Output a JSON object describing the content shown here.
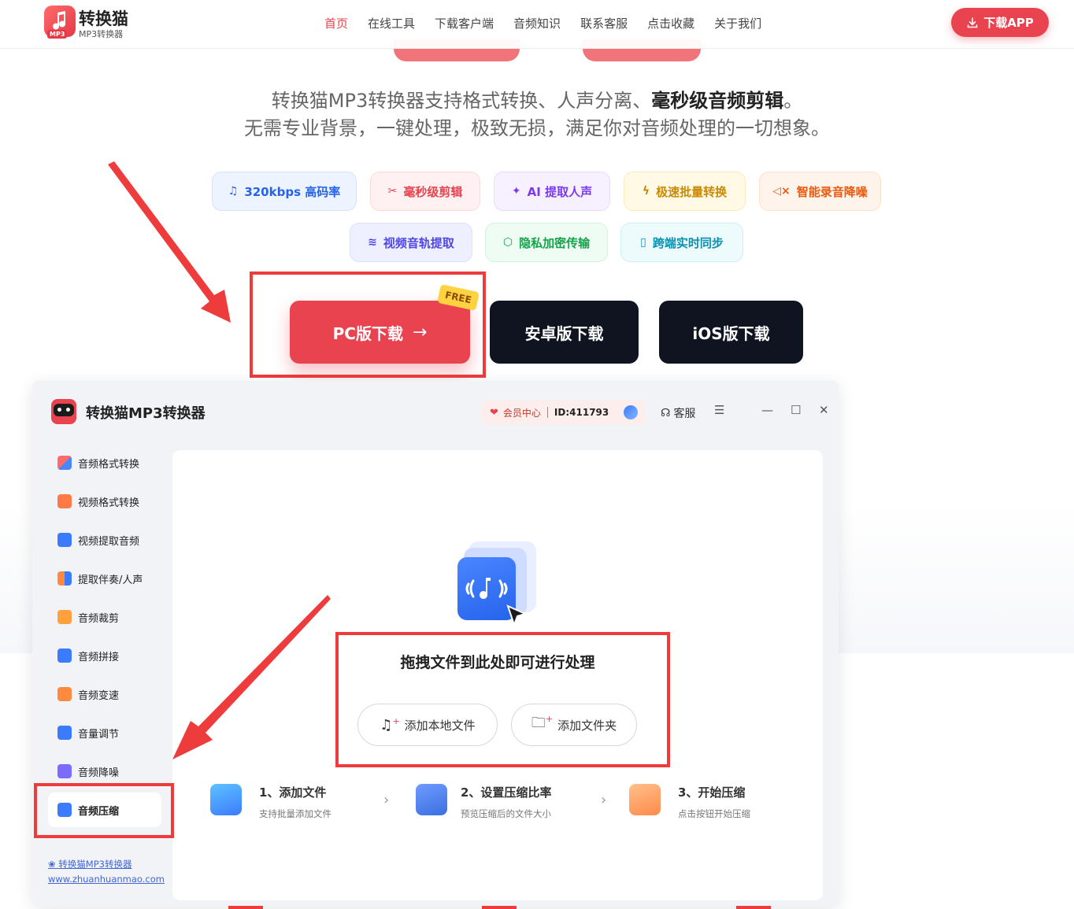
{
  "nav": {
    "logo_title": "转换猫",
    "logo_sub": "MP3转换器",
    "logo_badge": "MP3",
    "items": [
      "首页",
      "在线工具",
      "下载客户端",
      "音频知识",
      "联系客服",
      "点击收藏",
      "关于我们"
    ],
    "download_app": "下载APP"
  },
  "hero": {
    "line1_plain": "转换猫MP3转换器支持格式转换、人声分离、",
    "line1_bold": "毫秒级音频剪辑",
    "line1_end": "。",
    "line2": "无需专业背景，一键处理，极致无损，满足你对音频处理的一切想象。"
  },
  "pills": [
    {
      "label": "320kbps 高码率",
      "icon": "music-note-icon",
      "color": "#2563eb"
    },
    {
      "label": "毫秒级剪辑",
      "icon": "scissors-icon",
      "color": "#e8434f"
    },
    {
      "label": "AI 提取人声",
      "icon": "magic-wand-icon",
      "color": "#7c3aed"
    },
    {
      "label": "极速批量转换",
      "icon": "lightning-icon",
      "color": "#ca8a04"
    },
    {
      "label": "智能录音降噪",
      "icon": "mute-icon",
      "color": "#ea580c"
    },
    {
      "label": "视频音轨提取",
      "icon": "layers-icon",
      "color": "#4f46e5"
    },
    {
      "label": "隐私加密传输",
      "icon": "shield-icon",
      "color": "#16a34a"
    },
    {
      "label": "跨端实时同步",
      "icon": "phone-icon",
      "color": "#0891b2"
    }
  ],
  "downloads": {
    "pc": "PC版下载",
    "free": "FREE",
    "android": "安卓版下载",
    "ios": "iOS版下载"
  },
  "app": {
    "title": "转换猫MP3转换器",
    "vip": "会员中心",
    "uid": "ID:411793",
    "service": "客服",
    "sidebar": [
      {
        "label": "音频格式转换",
        "icon": "audio-convert-icon",
        "color": "#4a86ff"
      },
      {
        "label": "视频格式转换",
        "icon": "video-play-icon",
        "color": "#ff7a45"
      },
      {
        "label": "视频提取音频",
        "icon": "video-extract-icon",
        "color": "#3b7bff"
      },
      {
        "label": "提取伴奏/人声",
        "icon": "vocal-split-icon",
        "color": "#ff8a3d"
      },
      {
        "label": "音频裁剪",
        "icon": "audio-cut-icon",
        "color": "#ffa23d"
      },
      {
        "label": "音频拼接",
        "icon": "audio-merge-icon",
        "color": "#3b7bff"
      },
      {
        "label": "音频变速",
        "icon": "speed-icon",
        "color": "#ff8a3d"
      },
      {
        "label": "音量调节",
        "icon": "volume-icon",
        "color": "#3b7bff"
      },
      {
        "label": "音频降噪",
        "icon": "denoise-icon",
        "color": "#7b6cff"
      },
      {
        "label": "音频压缩",
        "icon": "compress-icon",
        "color": "#3b7bff"
      }
    ],
    "footer_link": "转换猫MP3转换器",
    "footer_url": "www.zhuanhuanmao.com",
    "drop_text": "拖拽文件到此处即可进行处理",
    "add_file": "添加本地文件",
    "add_folder": "添加文件夹",
    "steps": [
      {
        "title": "1、添加文件",
        "sub": "支持批量添加文件",
        "icon": "music-file-icon"
      },
      {
        "title": "2、设置压缩比率",
        "sub": "预览压缩后的文件大小",
        "icon": "audio-wave-icon"
      },
      {
        "title": "3、开始压缩",
        "sub": "点击按钮开始压缩",
        "icon": "refresh-icon"
      }
    ]
  },
  "colors": {
    "brand_red": "#e8434f",
    "annotation_red": "#ee3b3b",
    "dark_button": "#0f1420"
  }
}
